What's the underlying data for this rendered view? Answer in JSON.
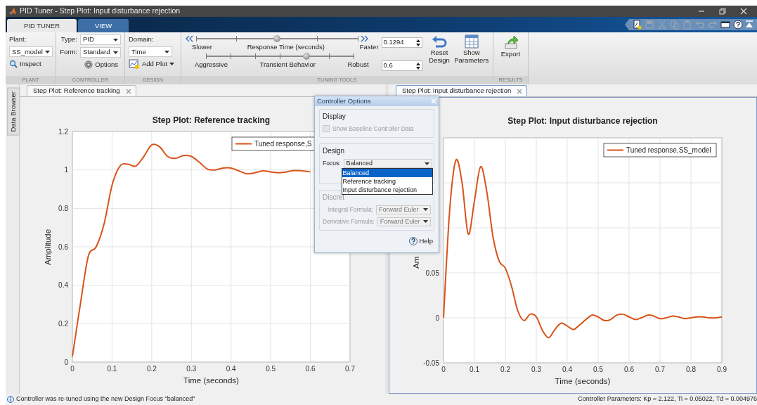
{
  "window": {
    "title": "PID Tuner - Step Plot: Input disturbance rejection"
  },
  "ribbon_tabs": [
    {
      "label": "PID TUNER",
      "selected": true
    },
    {
      "label": "VIEW",
      "selected": false
    }
  ],
  "quick_access": [
    {
      "kind": "new",
      "disabled": false
    },
    {
      "kind": "save",
      "disabled": true
    },
    {
      "kind": "cut",
      "disabled": true
    },
    {
      "kind": "copy",
      "disabled": true
    },
    {
      "kind": "paste",
      "disabled": true
    },
    {
      "kind": "undo",
      "disabled": true
    },
    {
      "kind": "redo",
      "disabled": true
    },
    {
      "kind": "window",
      "disabled": false
    },
    {
      "kind": "help",
      "disabled": false
    }
  ],
  "plant": {
    "label": "Plant:",
    "value": "SS_model",
    "inspect": "Inspect",
    "section": "PLANT"
  },
  "controller": {
    "type_label": "Type:",
    "type": "PID",
    "form_label": "Form:",
    "form": "Standard",
    "options": "Options",
    "section": "CONTROLLER"
  },
  "design": {
    "domain_label": "Domain:",
    "domain": "Time",
    "add_plot": "Add Plot",
    "section": "DESIGN"
  },
  "tuning": {
    "sliders": [
      {
        "kind": "response",
        "left": "Slower",
        "label": "Response Time (seconds)",
        "right": "Faster",
        "level": 0.5,
        "value": "0.1294"
      },
      {
        "kind": "transient",
        "left": "Aggressive",
        "label": "Transient Behavior",
        "right": "Robust",
        "level": 0.68,
        "value": "0.6"
      }
    ],
    "reset": "Reset Design",
    "show_parameters": "Show Parameters",
    "section": "TUNING TOOLS"
  },
  "results": {
    "export": "Export",
    "section": "RESULTS"
  },
  "side_tab": "Data Browser",
  "documents": [
    {
      "tab": "Step Plot: Reference tracking",
      "selected": false,
      "chart_data": {
        "type": "line",
        "title": "Step Plot: Reference tracking",
        "xlabel": "Time (seconds)",
        "ylabel": "Amplitude",
        "grid": true,
        "xlim": [
          0,
          0.7
        ],
        "ylim": [
          0,
          1.2
        ],
        "xticks": [
          0,
          0.1,
          0.2,
          0.3,
          0.4,
          0.5,
          0.6,
          0.7
        ],
        "yticks": [
          0,
          0.2,
          0.4,
          0.6,
          0.8,
          1,
          1.2
        ],
        "x": [
          0,
          0.02,
          0.04,
          0.06,
          0.08,
          0.1,
          0.12,
          0.14,
          0.16,
          0.18,
          0.2,
          0.22,
          0.24,
          0.26,
          0.28,
          0.3,
          0.32,
          0.34,
          0.36,
          0.38,
          0.4,
          0.42,
          0.44,
          0.46,
          0.48,
          0.5,
          0.52,
          0.54,
          0.56,
          0.58,
          0.6
        ],
        "series": [
          {
            "name": "Tuned response,S",
            "color": "#d95319",
            "values": [
              0.03,
              0.3,
              0.55,
              0.6,
              0.72,
              0.92,
              1.02,
              1.03,
              1.02,
              1.07,
              1.13,
              1.12,
              1.07,
              1.06,
              1.075,
              1.07,
              1.04,
              1.005,
              1.0,
              1.01,
              1.01,
              0.995,
              0.98,
              0.985,
              0.995,
              0.99,
              0.985,
              0.99,
              0.997,
              0.995,
              0.99
            ]
          }
        ]
      }
    },
    {
      "tab": "Step Plot: Input disturbance rejection",
      "selected": true,
      "chart_data": {
        "type": "line",
        "title": "Step Plot: Input disturbance rejection",
        "xlabel": "Time (seconds)",
        "ylabel": "Am",
        "grid": true,
        "xlim": [
          0,
          0.9
        ],
        "ylim": [
          -0.05,
          0.2
        ],
        "xticks": [
          0,
          0.1,
          0.2,
          0.3,
          0.4,
          0.5,
          0.6,
          0.7,
          0.8,
          0.9
        ],
        "yticks": [
          -0.05,
          0,
          0.05
        ],
        "x": [
          0,
          0.02,
          0.04,
          0.06,
          0.08,
          0.1,
          0.12,
          0.14,
          0.16,
          0.18,
          0.2,
          0.22,
          0.24,
          0.26,
          0.28,
          0.3,
          0.32,
          0.34,
          0.36,
          0.38,
          0.4,
          0.42,
          0.44,
          0.46,
          0.48,
          0.5,
          0.52,
          0.54,
          0.56,
          0.58,
          0.6,
          0.62,
          0.64,
          0.66,
          0.68,
          0.7,
          0.72,
          0.74,
          0.76,
          0.78,
          0.8,
          0.82,
          0.84,
          0.86,
          0.88,
          0.9
        ],
        "series": [
          {
            "name": "Tuned response,SS_model",
            "color": "#d95319",
            "values": [
              0,
              0.12,
              0.175,
              0.15,
              0.093,
              0.13,
              0.168,
              0.14,
              0.09,
              0.063,
              0.055,
              0.035,
              0.008,
              -0.003,
              0.004,
              0.001,
              -0.014,
              -0.022,
              -0.013,
              -0.006,
              -0.009,
              -0.013,
              -0.008,
              -0.002,
              0.003,
              0.001,
              -0.003,
              -0.002,
              0.003,
              0.004,
              0.001,
              -0.002,
              0,
              0.003,
              0.002,
              -0.001,
              0,
              0.002,
              0.001,
              -0.001,
              0,
              0.001,
              0.001,
              0,
              0,
              0.001
            ]
          }
        ]
      }
    }
  ],
  "dialog": {
    "title": "Controller Options",
    "display": {
      "legend": "Display",
      "checkbox": {
        "label": "Show Baseline Controller Data",
        "checked": false,
        "disabled": true
      }
    },
    "design": {
      "legend": "Design",
      "focus_label": "Focus:",
      "focus": "Balanced",
      "options": [
        {
          "label": "Balanced",
          "selected": true
        },
        {
          "label": "Reference tracking",
          "selected": false
        },
        {
          "label": "Input disturbance rejection",
          "selected": false
        }
      ]
    },
    "discretization": {
      "legend": "Discret",
      "fields": [
        {
          "label": "Integral Formula:",
          "value": "Forward Euler",
          "disabled": true
        },
        {
          "label": "Derivative Formula:",
          "value": "Forward Euler",
          "disabled": true
        }
      ]
    },
    "help": "Help"
  },
  "status_bar": {
    "message": "Controller was re-tuned using the new Design Focus \"balanced\"",
    "parameters": "Controller Parameters: Kp = 2.122, Ti = 0.05022, Td = 0.004976"
  }
}
